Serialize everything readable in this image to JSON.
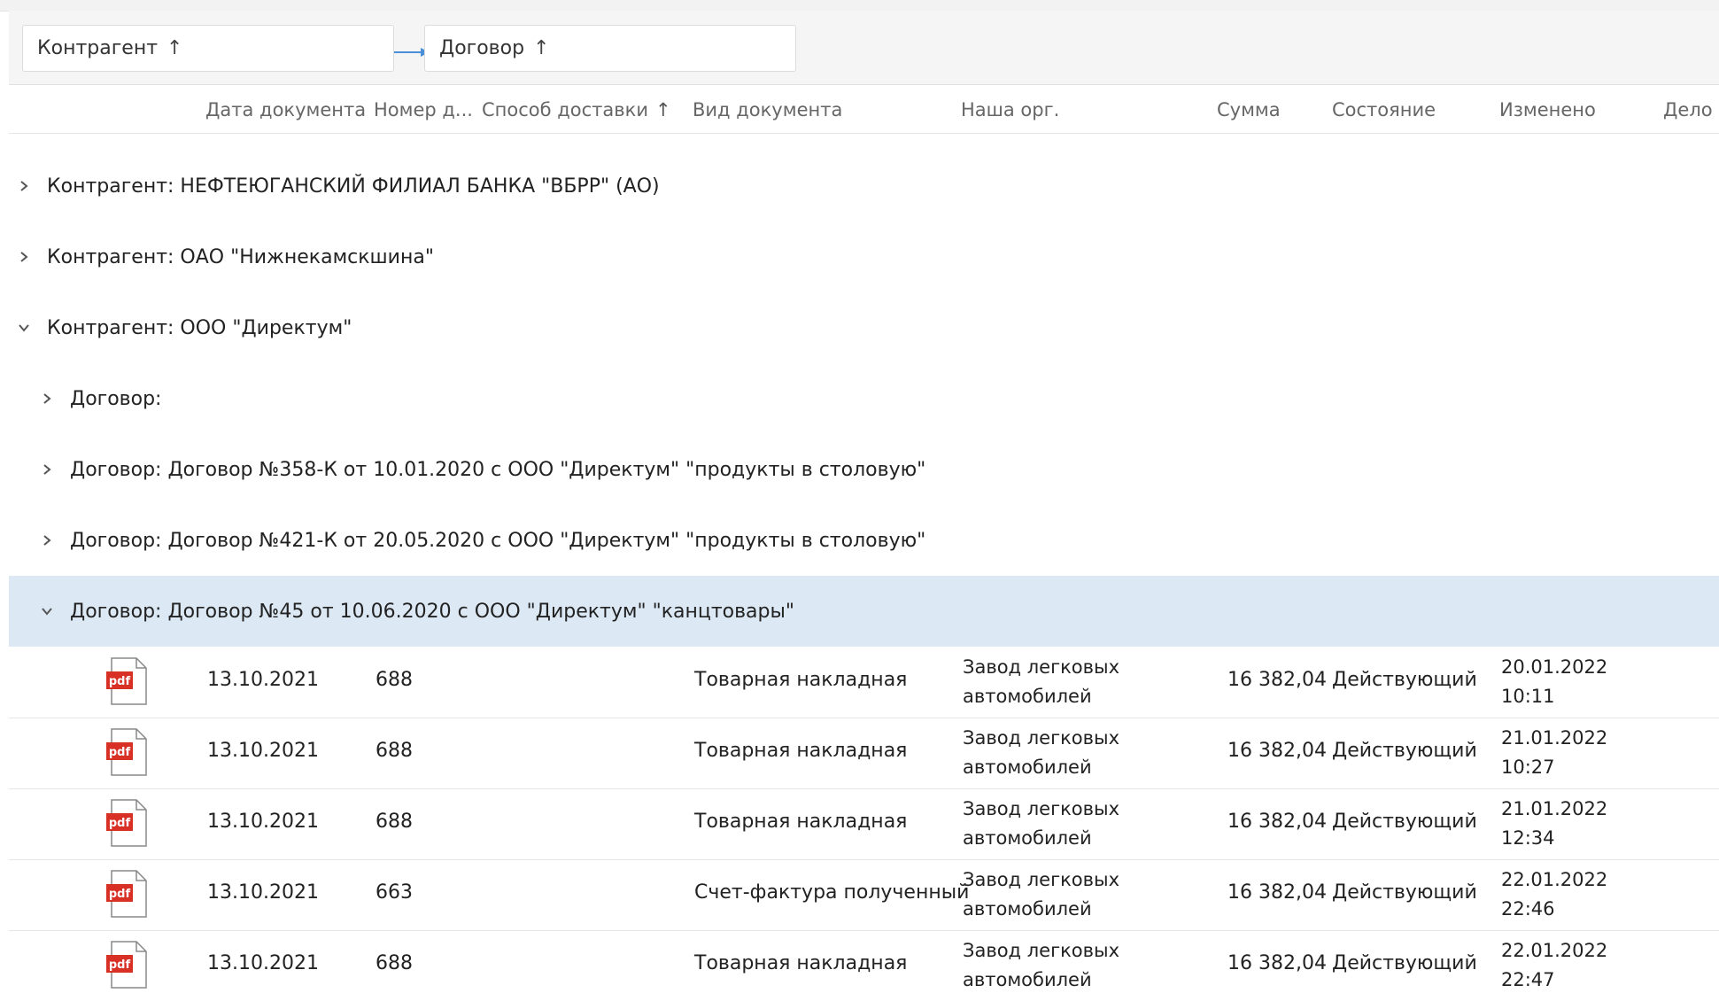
{
  "grouping": {
    "chips": [
      {
        "label": "Контрагент",
        "sort": "↑"
      },
      {
        "label": "Договор",
        "sort": "↑"
      }
    ]
  },
  "columns": [
    {
      "label": "Дата документа"
    },
    {
      "label": "Номер д..."
    },
    {
      "label": "Способ доставки",
      "sort": "↑"
    },
    {
      "label": "Вид документа"
    },
    {
      "label": "Наша орг."
    },
    {
      "label": "Сумма"
    },
    {
      "label": "Состояние"
    },
    {
      "label": "Изменено"
    },
    {
      "label": "Дело"
    }
  ],
  "groups": [
    {
      "label": "Контрагент: НЕФТЕЮГАНСКИЙ ФИЛИАЛ БАНКА \"ВБРР\" (АО)",
      "expanded": false
    },
    {
      "label": "Контрагент: ОАО \"Нижнекамскшина\"",
      "expanded": false
    },
    {
      "label": "Контрагент: ООО \"Директум\"",
      "expanded": true
    },
    {
      "label": "Договор:",
      "expanded": false
    },
    {
      "label": "Договор: Договор №358-К от 10.01.2020 с ООО \"Директум\" \"продукты в столовую\"",
      "expanded": false
    },
    {
      "label": "Договор: Договор №421-К от 20.05.2020 с ООО \"Директум\" \"продукты в столовую\"",
      "expanded": false
    },
    {
      "label": "Договор: Договор №45 от 10.06.2020 с ООО \"Директум\" \"канцтовары\"",
      "expanded": true
    }
  ],
  "rows": [
    {
      "icon": "pdf",
      "date": "13.10.2021",
      "number": "688",
      "type": "Товарная накладная",
      "org_line1": "Завод легковых",
      "org_line2": "автомобилей",
      "sum": "16 382,04",
      "state": "Действующий",
      "changed_date": "20.01.2022",
      "changed_time": "10:11"
    },
    {
      "icon": "pdf",
      "date": "13.10.2021",
      "number": "688",
      "type": "Товарная накладная",
      "org_line1": "Завод легковых",
      "org_line2": "автомобилей",
      "sum": "16 382,04",
      "state": "Действующий",
      "changed_date": "21.01.2022",
      "changed_time": "10:27"
    },
    {
      "icon": "pdf",
      "date": "13.10.2021",
      "number": "688",
      "type": "Товарная накладная",
      "org_line1": "Завод легковых",
      "org_line2": "автомобилей",
      "sum": "16 382,04",
      "state": "Действующий",
      "changed_date": "21.01.2022",
      "changed_time": "12:34"
    },
    {
      "icon": "pdf",
      "date": "13.10.2021",
      "number": "663",
      "type": "Счет-фактура полученный",
      "org_line1": "Завод легковых",
      "org_line2": "автомобилей",
      "sum": "16 382,04",
      "state": "Действующий",
      "changed_date": "22.01.2022",
      "changed_time": "22:46"
    },
    {
      "icon": "pdf",
      "date": "13.10.2021",
      "number": "688",
      "type": "Товарная накладная",
      "org_line1": "Завод легковых",
      "org_line2": "автомобилей",
      "sum": "16 382,04",
      "state": "Действующий",
      "changed_date": "22.01.2022",
      "changed_time": "22:47"
    }
  ],
  "colors": {
    "selected_row": "#dce9f5",
    "pdf_red": "#d93025",
    "link_arrow": "#4a90d9"
  }
}
